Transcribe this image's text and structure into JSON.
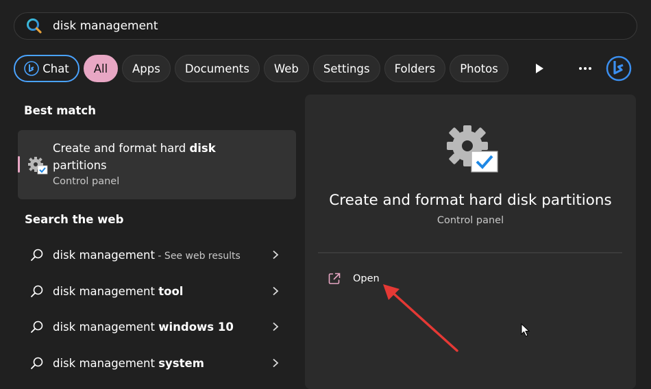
{
  "search": {
    "value": "disk management",
    "placeholder": ""
  },
  "filters": {
    "chat_label": "Chat",
    "tabs": [
      "All",
      "Apps",
      "Documents",
      "Web",
      "Settings",
      "Folders",
      "Photos"
    ]
  },
  "best_match": {
    "heading": "Best match",
    "title_plain": "Create and format hard ",
    "title_bold": "disk",
    "title_rest": "partitions",
    "subtitle": "Control panel"
  },
  "web": {
    "heading": "Search the web",
    "items": [
      {
        "query": "disk management",
        "bold": "",
        "hint": " - See web results"
      },
      {
        "query": "disk management ",
        "bold": "tool",
        "hint": ""
      },
      {
        "query": "disk management ",
        "bold": "windows 10",
        "hint": ""
      },
      {
        "query": "disk management ",
        "bold": "system",
        "hint": ""
      }
    ]
  },
  "detail": {
    "title": "Create and format hard disk partitions",
    "subtitle": "Control panel",
    "open_label": "Open"
  },
  "colors": {
    "accent_pink": "#e8a7c4",
    "chat_border": "#4aa3ff",
    "annotation_red": "#e53935"
  }
}
